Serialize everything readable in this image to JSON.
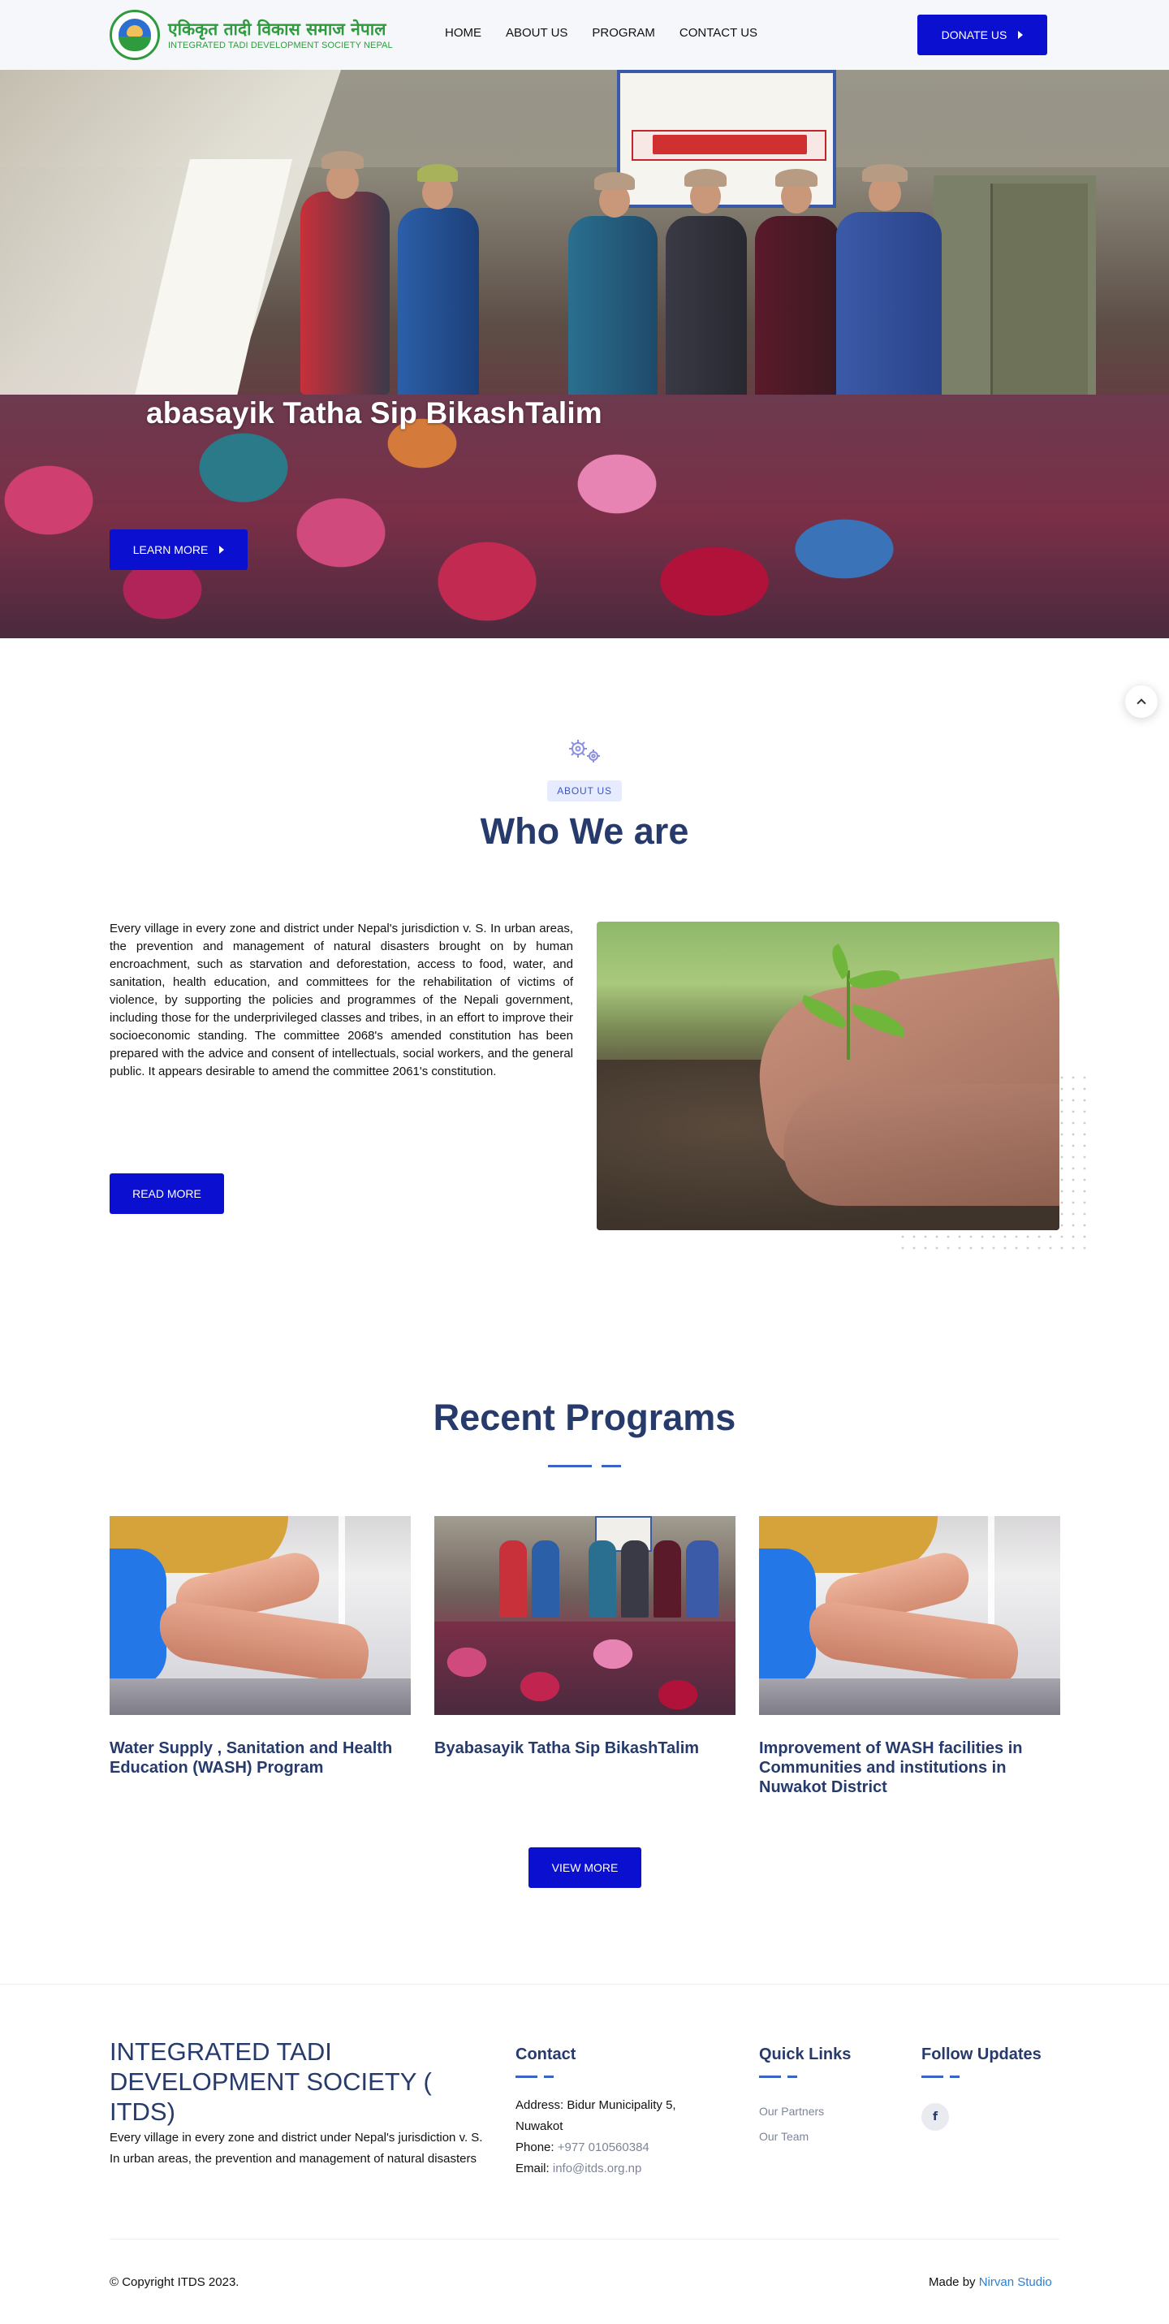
{
  "brand": {
    "name_np": "एकिकृत तादी विकास समाज नेपाल",
    "name_en": "INTEGRATED TADI DEVELOPMENT SOCIETY NEPAL",
    "accent": "#0a0fd0",
    "heading_color": "#263a6b"
  },
  "nav": {
    "items": [
      "HOME",
      "ABOUT US",
      "PROGRAM",
      "CONTACT US"
    ],
    "donate_label": "DONATE US"
  },
  "hero": {
    "title": "abasayik Tatha Sip BikashTalim",
    "cta_label": "LEARN MORE"
  },
  "about": {
    "badge": "ABOUT US",
    "title": "Who We are",
    "body": "Every village in every zone and district under Nepal's jurisdiction v. S. In urban areas, the prevention and management of natural disasters brought on by human encroachment, such as starvation and deforestation, access to food, water, and sanitation, health education, and committees for the rehabilitation of victims of violence, by supporting the policies and programmes of the Nepali government, including those for the underprivileged classes and tribes, in an effort to improve their socioeconomic standing. The committee 2068's amended constitution has been prepared with the advice and consent of intellectuals, social workers, and the general public. It appears desirable to amend the committee 2061's constitution.",
    "cta_label": "READ MORE"
  },
  "programs": {
    "title": "Recent Programs",
    "cards": [
      {
        "title": "Water Supply , Sanitation and Health Education (WASH) Program"
      },
      {
        "title": "Byabasayik Tatha Sip BikashTalim"
      },
      {
        "title": "Improvement of WASH facilities in Communities and institutions in Nuwakot District"
      }
    ],
    "cta_label": "VIEW MORE"
  },
  "footer": {
    "org": "INTEGRATED TADI DEVELOPMENT SOCIETY ( ITDS)",
    "about": "Every village in every zone and district under Nepal's jurisdiction v. S. In urban areas, the prevention and management of natural disasters",
    "contact": {
      "heading": "Contact",
      "address_label": "Address:",
      "address": "Bidur Municipality 5, Nuwakot",
      "phone_label": "Phone:",
      "phone": "+977 010560384",
      "email_label": "Email:",
      "email": "info@itds.org.np"
    },
    "quick_links": {
      "heading": "Quick Links",
      "items": [
        "Our Partners",
        "Our Team"
      ]
    },
    "follow": {
      "heading": "Follow Updates",
      "icon": "facebook-icon",
      "glyph": "f"
    },
    "copyright": "© Copyright ITDS 2023.",
    "made_by_label": "Made by",
    "made_by_name": "Nirvan Studio"
  }
}
